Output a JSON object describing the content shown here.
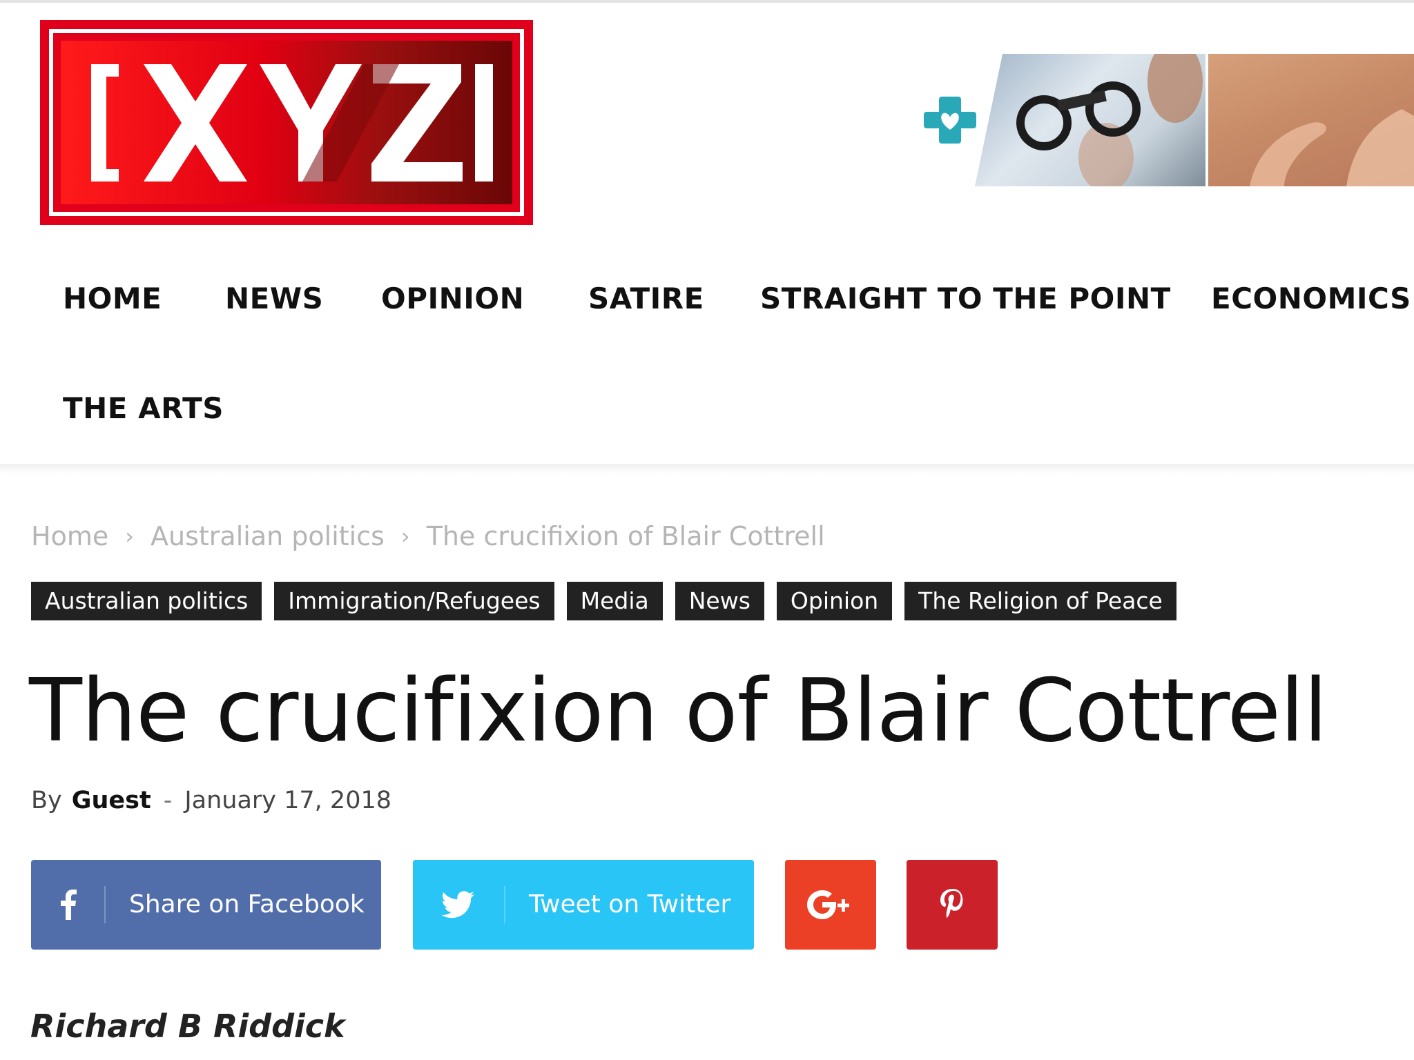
{
  "site": {
    "logo_text": "XYZ",
    "logo_colors": {
      "red": "#e0001b",
      "dark_red": "#7a0a0a",
      "white": "#ffffff"
    }
  },
  "ad": {
    "icon": "medical-cross-heart-icon",
    "accent": "#29a9b8"
  },
  "nav": {
    "items": [
      {
        "label": "HOME"
      },
      {
        "label": "NEWS"
      },
      {
        "label": "OPINION"
      },
      {
        "label": "SATIRE"
      },
      {
        "label": "STRAIGHT TO THE POINT"
      },
      {
        "label": "ECONOMICS"
      },
      {
        "label": "THE ARTS"
      }
    ]
  },
  "breadcrumb": {
    "items": [
      "Home",
      "Australian politics",
      "The crucifixion of Blair Cottrell"
    ],
    "separator": "›"
  },
  "tags": [
    "Australian politics",
    "Immigration/Refugees",
    "Media",
    "News",
    "Opinion",
    "The Religion of Peace"
  ],
  "article": {
    "title": "The crucifixion of Blair Cottrell",
    "by_label": "By",
    "author": "Guest",
    "dash": "-",
    "date": "January 17, 2018",
    "byline": "Richard B Riddick"
  },
  "share": {
    "facebook": {
      "label": "Share on Facebook",
      "icon": "facebook-icon",
      "color": "#516eab"
    },
    "twitter": {
      "label": "Tweet on Twitter",
      "icon": "twitter-icon",
      "color": "#29c5f6"
    },
    "googleplus": {
      "icon": "google-plus-icon",
      "color": "#eb4026"
    },
    "pinterest": {
      "icon": "pinterest-icon",
      "color": "#ca212a"
    }
  }
}
